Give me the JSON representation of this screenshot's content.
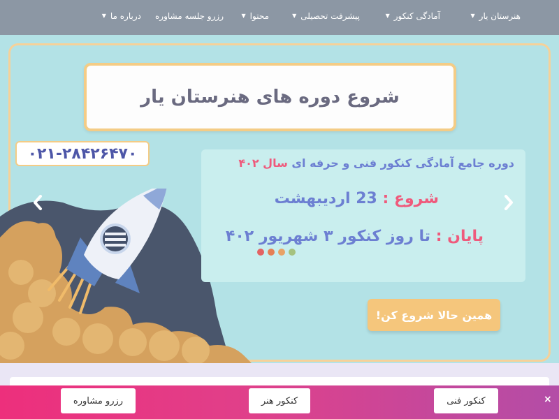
{
  "nav": {
    "items": [
      {
        "label": "هنرستان یار"
      },
      {
        "label": "آمادگی کنکور"
      },
      {
        "label": "پیشرفت تحصیلی"
      },
      {
        "label": "محتوا"
      },
      {
        "label": "رزرو جلسه مشاوره"
      },
      {
        "label": "درباره ما"
      }
    ]
  },
  "hero": {
    "title": "شروع دوره های هنرستان یار",
    "phone": "۰۲۱-۲۸۴۲۶۴۷۰",
    "course_pre": "دوره",
    "course_mid": " جامع آمادگی کنکور فنی و حرفه ای ",
    "course_year": "سال ۴۰۲",
    "start_label": "شروع :",
    "start_value": "23 اردیبهشت",
    "end_label": "پایان :",
    "end_value": "تا روز کنکور ۳ شهریور ۴۰۲",
    "cta_label": "همین حالا شروع کن!",
    "dot_colors": [
      "#e36363",
      "#e57f55",
      "#e8a266",
      "#a5c27f"
    ]
  },
  "bottom_bar": {
    "btn_fanni": "کنکور فنی",
    "btn_honar": "کنکور هنر",
    "btn_moshavere": "رزرو مشاوره",
    "close_icon": "×"
  }
}
